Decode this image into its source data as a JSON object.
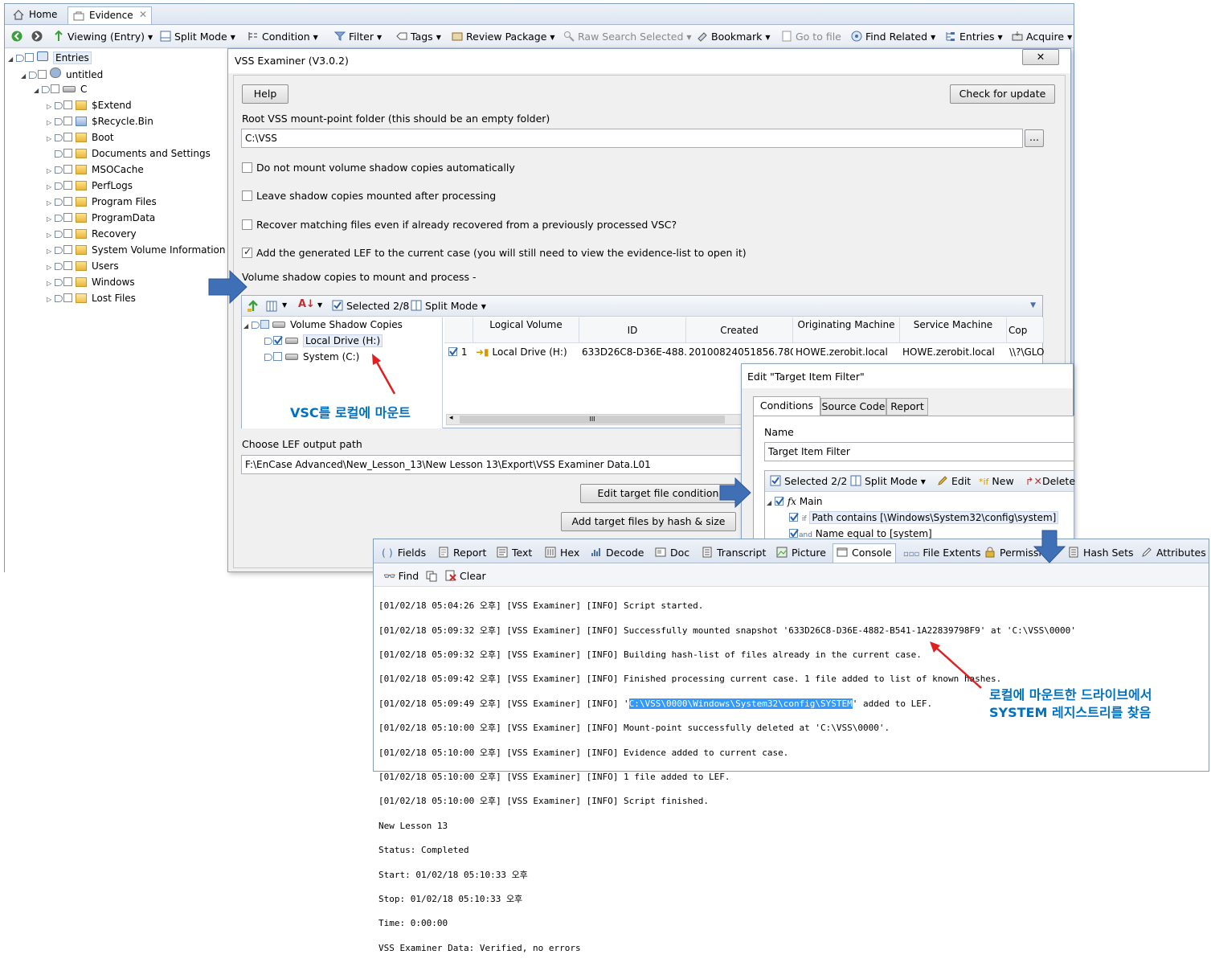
{
  "tabs": [
    {
      "label": "Home"
    },
    {
      "label": "Evidence"
    }
  ],
  "toolbar": {
    "viewing": "Viewing (Entry)",
    "split_mode": "Split Mode",
    "condition": "Condition",
    "filter": "Filter",
    "tags": "Tags",
    "review_package": "Review Package",
    "raw_search_selected": "Raw Search Selected",
    "bookmark": "Bookmark",
    "go_to_file": "Go to file",
    "find_related": "Find Related",
    "entries": "Entries",
    "acquire": "Acquire"
  },
  "tree": {
    "root": "Entries",
    "case": "untitled",
    "drive": "C",
    "folders": [
      "$Extend",
      "$Recycle.Bin",
      "Boot",
      "Documents and Settings",
      "MSOCache",
      "PerfLogs",
      "Program Files",
      "ProgramData",
      "Recovery",
      "System Volume Information",
      "Users",
      "Windows",
      "Lost Files"
    ]
  },
  "vss": {
    "title": "VSS Examiner (V3.0.2)",
    "help": "Help",
    "check_update": "Check for update",
    "root_label": "Root VSS mount-point folder (this should be an empty folder)",
    "root_value": "C:\\VSS",
    "browse": "...",
    "options": [
      {
        "label": "Do not mount volume shadow copies automatically",
        "checked": false
      },
      {
        "label": "Leave shadow copies mounted after processing",
        "checked": false
      },
      {
        "label": "Recover matching files even if already recovered from a previously processed VSC?",
        "checked": false
      },
      {
        "label": "Add the generated LEF to the current case (you will still need to view the evidence-list to open it)",
        "checked": true
      }
    ],
    "copies_label": "Volume shadow copies to mount and process -",
    "panel_toolbar": {
      "selected": "Selected 2/8",
      "split_mode": "Split Mode"
    },
    "copies_tree": {
      "root": "Volume Shadow Copies",
      "items": [
        "Local Drive (H:)",
        "System (C:)"
      ]
    },
    "table": {
      "headers": [
        "Logical Volume",
        "ID",
        "Created",
        "Originating Machine",
        "Service Machine",
        "Cop"
      ],
      "row": {
        "num": "1",
        "volume": "Local Drive (H:)",
        "id": "633D26C8-D36E-488...",
        "created": "20100824051856.780...",
        "orig": "HOWE.zerobit.local",
        "service": "HOWE.zerobit.local",
        "copy": "\\\\?\\GLO"
      }
    },
    "lef_label": "Choose LEF output path",
    "lef_value": "F:\\EnCase Advanced\\New_Lesson_13\\New Lesson 13\\Export\\VSS Examiner Data.L01",
    "edit_condition": "Edit target file condition",
    "add_hash": "Add target files by hash & size"
  },
  "filter_dialog": {
    "title": "Edit \"Target Item Filter\"",
    "tabs": [
      "Conditions",
      "Source Code",
      "Report"
    ],
    "name_label": "Name",
    "name_value": "Target Item Filter",
    "toolbar": {
      "selected": "Selected 2/2",
      "split_mode": "Split Mode",
      "edit": "Edit",
      "new": "New",
      "delete": "Delete"
    },
    "tree": {
      "main": "Main",
      "if_kw": "if",
      "cond1": "Path contains [\\Windows\\System32\\config\\system]",
      "and_kw": "and",
      "cond2": "Name equal to [system]"
    }
  },
  "console": {
    "tabs": [
      "Fields",
      "Report",
      "Text",
      "Hex",
      "Decode",
      "Doc",
      "Transcript",
      "Picture",
      "Console",
      "File Extents",
      "Permissio",
      "Hash Sets",
      "Attributes"
    ],
    "find": "Find",
    "clear": "Clear",
    "lines": [
      "[01/02/18 05:04:26 오후] [VSS Examiner] [INFO] Script started.",
      "[01/02/18 05:09:32 오후] [VSS Examiner] [INFO] Successfully mounted snapshot '633D26C8-D36E-4882-B541-1A22839798F9' at 'C:\\VSS\\0000'",
      "[01/02/18 05:09:32 오후] [VSS Examiner] [INFO] Building hash-list of files already in the current case.",
      "[01/02/18 05:09:42 오후] [VSS Examiner] [INFO] Finished processing current case. 1 file added to list of known hashes.",
      "[01/02/18 05:09:49 오후] [VSS Examiner] [INFO] '",
      "[01/02/18 05:10:00 오후] [VSS Examiner] [INFO] Mount-point successfully deleted at 'C:\\VSS\\0000'.",
      "[01/02/18 05:10:00 오후] [VSS Examiner] [INFO] Evidence added to current case.",
      "[01/02/18 05:10:00 오후] [VSS Examiner] [INFO] 1 file added to LEF.",
      "[01/02/18 05:10:00 오후] [VSS Examiner] [INFO] Script finished.",
      "New Lesson 13",
      "Status: Completed",
      "Start: 01/02/18 05:10:33 오후",
      "Stop: 01/02/18 05:10:33 오후",
      "Time: 0:00:00",
      "VSS Examiner Data: Verified, no errors"
    ],
    "highlight": "C:\\VSS\\0000\\Windows\\System32\\config\\SYSTEM",
    "highlight_suffix": "' added to LEF."
  },
  "annotations": {
    "mount_note": "VSC를 로컬에 마운트",
    "registry_note_1": "로컬에 마운트한 드라이브에서",
    "registry_note_2": "SYSTEM 레지스트리를 찾음"
  },
  "colors": {
    "arrow_blue": "#3f6fb5",
    "note_blue": "#0070c0",
    "red_arrow": "#e02020",
    "highlight": "#3399ff"
  }
}
